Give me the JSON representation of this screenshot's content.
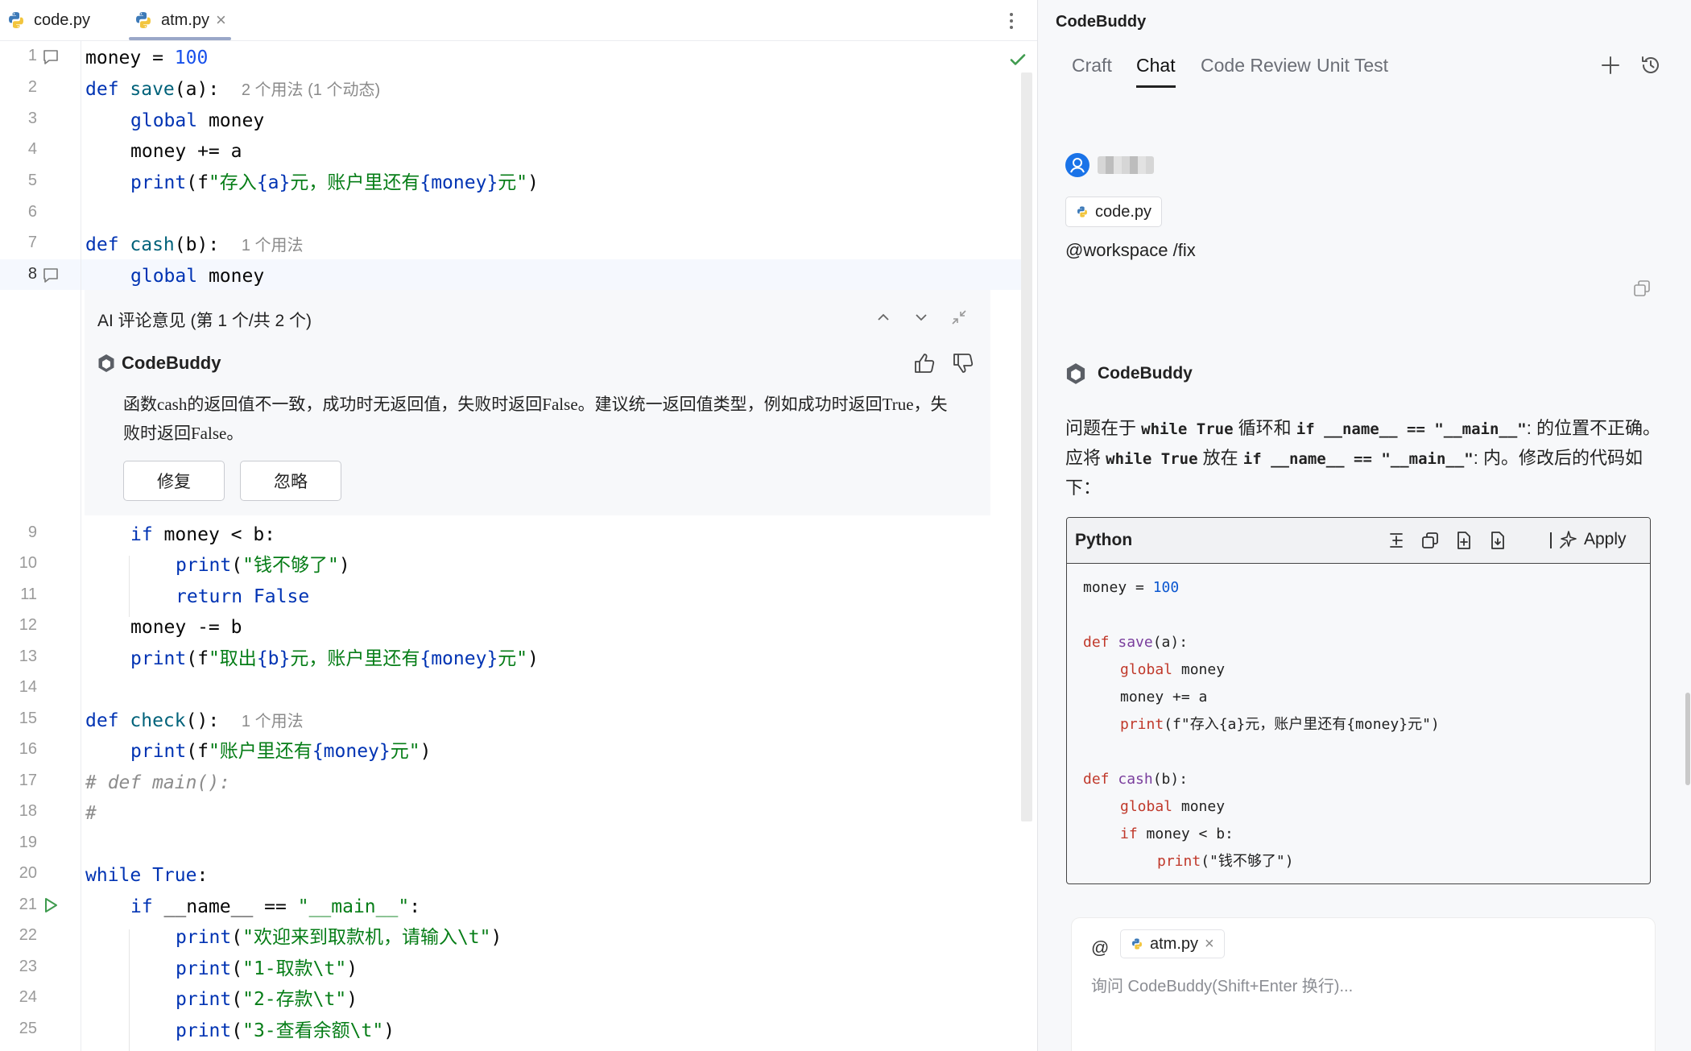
{
  "editor": {
    "tabs": [
      {
        "label": "code.py",
        "active": false
      },
      {
        "label": "atm.py",
        "active": true
      }
    ],
    "line_numbers": [
      "1",
      "2",
      "3",
      "4",
      "5",
      "6",
      "7",
      "8",
      "9",
      "10",
      "11",
      "12",
      "13",
      "14",
      "15",
      "16",
      "17",
      "18",
      "19",
      "20",
      "21",
      "22",
      "23",
      "24",
      "25"
    ],
    "code": {
      "l1_a": "money = ",
      "l1_b": "100",
      "l2_kw": "def ",
      "l2_fn": "save",
      "l2_rest": "(a):",
      "l2_hint": "2 个用法 (1 个动态)",
      "l3_kw": "global",
      "l3_rest": " money",
      "l4": "money += a",
      "l5_fn": "print",
      "l5_a": "(f",
      "l5_s1": "\"存入",
      "l5_v1": "{a}",
      "l5_s2": "元，账户里还有",
      "l5_v2": "{money}",
      "l5_s3": "元\"",
      "l5_e": ")",
      "l7_kw": "def ",
      "l7_fn": "cash",
      "l7_rest": "(b):",
      "l7_hint": "1 个用法",
      "l8_kw": "global",
      "l8_rest": " money",
      "l9_kw": "if",
      "l9_rest": " money < b:",
      "l10_fn": "print",
      "l10_a": "(",
      "l10_s": "\"钱不够了\"",
      "l10_e": ")",
      "l11_kw": "return False",
      "l12": "money -= b",
      "l13_fn": "print",
      "l13_a": "(f",
      "l13_s1": "\"取出",
      "l13_v1": "{b}",
      "l13_s2": "元，账户里还有",
      "l13_v2": "{money}",
      "l13_s3": "元\"",
      "l13_e": ")",
      "l15_kw": "def ",
      "l15_fn": "check",
      "l15_rest": "():",
      "l15_hint": "1 个用法",
      "l16_fn": "print",
      "l16_a": "(f",
      "l16_s1": "\"账户里还有",
      "l16_v1": "{money}",
      "l16_s2": "元\"",
      "l16_e": ")",
      "l17": "# def main():",
      "l18": "#",
      "l20_kw": "while True",
      "l20_rest": ":",
      "l21_kw": "if",
      "l21_rest": " __name__ == ",
      "l21_s": "\"__main__\"",
      "l21_e": ":",
      "l22_fn": "print",
      "l22_a": "(",
      "l22_s": "\"欢迎来到取款机，请输入\\t\"",
      "l22_e": ")",
      "l23_fn": "print",
      "l23_a": "(",
      "l23_s": "\"1-取款\\t\"",
      "l23_e": ")",
      "l24_fn": "print",
      "l24_a": "(",
      "l24_s": "\"2-存款\\t\"",
      "l24_e": ")",
      "l25_fn": "print",
      "l25_a": "(",
      "l25_s": "\"3-查看余额\\t\"",
      "l25_e": ")"
    },
    "review": {
      "header": "AI 评论意见 (第 1 个/共 2 个)",
      "brand": "CodeBuddy",
      "message": "函数cash的返回值不一致，成功时无返回值，失败时返回False。建议统一返回值类型，例如成功时返回True，失败时返回False。",
      "fix_label": "修复",
      "ignore_label": "忽略"
    }
  },
  "chat": {
    "title": "CodeBuddy",
    "tabs": [
      "Craft",
      "Chat",
      "Code Review",
      "Unit Test"
    ],
    "active_tab": "Chat",
    "user": {
      "file_chip": "code.py",
      "message": "@workspace /fix"
    },
    "bot": {
      "name": "CodeBuddy",
      "msg_1": "问题在于 ",
      "msg_c1": "while True",
      "msg_2": " 循环和 ",
      "msg_c2": "if __name__ == \"__main__\"",
      "msg_3": ": 的位置不正确。应将 ",
      "msg_c3": "while True",
      "msg_4": " 放在 ",
      "msg_c4": "if __name__ == \"__main__\"",
      "msg_5": ": 内。修改后的代码如下："
    },
    "code_block": {
      "language": "Python",
      "apply_label": "Apply",
      "lines": {
        "c1_a": "money = ",
        "c1_b": "100",
        "c3_kw": "def ",
        "c3_fn": "save",
        "c3_rest": "(a):",
        "c4_kw": "global",
        "c4_rest": " money",
        "c5": "money += a",
        "c6_fn": "print",
        "c6_rest": "(f\"存入{a}元，账户里还有{money}元\")",
        "c8_kw": "def ",
        "c8_fn": "cash",
        "c8_rest": "(b):",
        "c9_kw": "global",
        "c9_rest": " money",
        "c10_kw": "if",
        "c10_rest": " money < b:",
        "c11_fn": "print",
        "c11_rest": "(\"钱不够了\")"
      }
    },
    "input": {
      "at": "@",
      "file_chip": "atm.py",
      "placeholder": "询问 CodeBuddy(Shift+Enter 换行)..."
    }
  }
}
